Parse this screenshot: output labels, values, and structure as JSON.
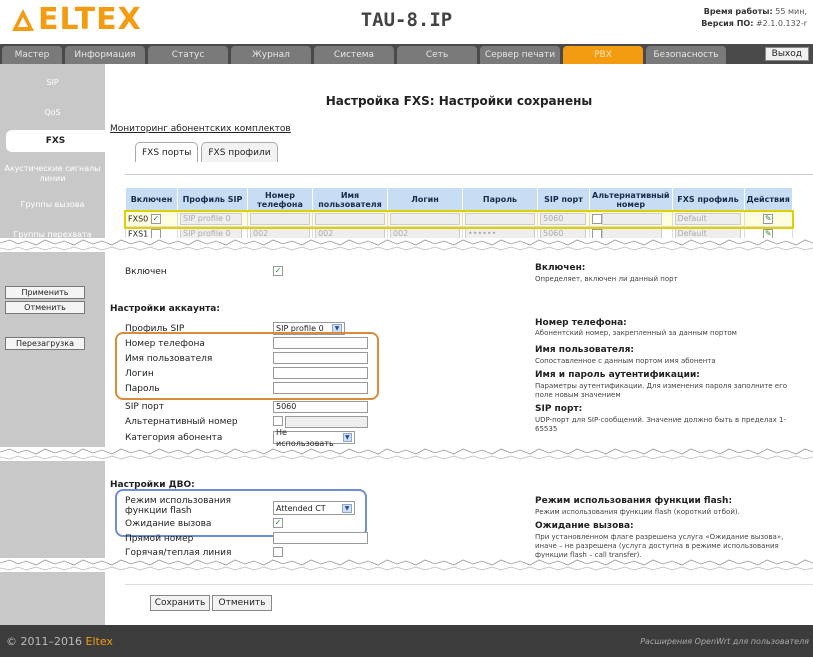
{
  "header": {
    "logo": "ELTEX",
    "device": "TAU-8.IP",
    "uptime_label": "Время работы:",
    "uptime_value": "55 мин,",
    "version_label": "Версия ПО:",
    "version_value": "#2.1.0.132-r"
  },
  "nav": {
    "tabs": [
      "Мастер",
      "Информация",
      "Статус",
      "Журнал",
      "Система",
      "Сеть",
      "Сервер печати",
      "PBX",
      "Безопасность"
    ],
    "exit": "Выход"
  },
  "sidebar": {
    "items": [
      "SIP",
      "QoS",
      "FXS",
      "Акустические сигналы линии",
      "Группы вызова",
      "Группы перехвата"
    ],
    "apply": "Применить",
    "cancel": "Отменить",
    "reboot": "Перезагрузка"
  },
  "main": {
    "title": "Настройка FXS: Настройки сохранены",
    "monitor_link": "Мониторинг абонентских комплектов",
    "subtabs": [
      "FXS порты",
      "FXS профили"
    ],
    "table": {
      "headers": [
        "Включен",
        "Профиль SIP",
        "Номер телефона",
        "Имя пользователя",
        "Логин",
        "Пароль",
        "SIP порт",
        "Альтернативный номер",
        "FXS профиль",
        "Действия"
      ],
      "rows": [
        {
          "port": "FXS0",
          "sip_profile": "SIP profile 0",
          "phone": "",
          "user": "",
          "login": "",
          "password": "",
          "sip_port": "5060",
          "fxs_profile": "Default"
        },
        {
          "port": "FXS1",
          "sip_profile": "SIP profile 0",
          "phone": "002",
          "user": "002",
          "login": "002",
          "password": "••••••",
          "sip_port": "5060",
          "fxs_profile": "Default"
        }
      ]
    },
    "enabled_label": "Включен",
    "account_title": "Настройки аккаунта:",
    "account": {
      "sip_profile_label": "Профиль SIP",
      "sip_profile_value": "SIP profile 0",
      "phone_label": "Номер телефона",
      "user_label": "Имя пользователя",
      "login_label": "Логин",
      "password_label": "Пароль",
      "sip_port_label": "SIP порт",
      "sip_port_value": "5060",
      "alt_label": "Альтернативный номер",
      "category_label": "Категория абонента",
      "category_value": "Не использовать"
    },
    "help": {
      "enabled_title": "Включен:",
      "enabled_text": "Определяет, включен ли данный порт",
      "phone_title": "Номер телефона:",
      "phone_text": "Абонентский номер, закрепленный за данным портом",
      "user_title": "Имя пользователя:",
      "user_text": "Сопоставленное с данным портом имя абонента",
      "auth_title": "Имя и пароль аутентификации:",
      "auth_text": "Параметры аутентификации. Для изменения пароля заполните его поле новым значением",
      "sipport_title": "SIP порт:",
      "sipport_text": "UDP-порт для SIP-сообщений. Значение должно быть в пределах 1-65535",
      "flash_title": "Режим использования функции flash:",
      "flash_text": "Режим использования функции flash (короткий отбой).",
      "cw_title": "Ожидание вызова:",
      "cw_text": "При установленном флаге разрешена услуга «Ожидание вызова», иначе – не разрешена (услуга доступна в режиме использования функции flash – call transfer)."
    },
    "dvo_title": "Настройки ДВО:",
    "dvo": {
      "flash_label": "Режим использования функции flash",
      "flash_value": "Attended CT",
      "cw_label": "Ожидание вызова",
      "direct_label": "Прямой номер",
      "hotline_label": "Горячая/теплая линия"
    },
    "save": "Сохранить",
    "cancel": "Отменить"
  },
  "footer": {
    "copyright": "© 2011–2016",
    "link": "Eltex",
    "ext": "Расширения OpenWrt для пользователя"
  }
}
